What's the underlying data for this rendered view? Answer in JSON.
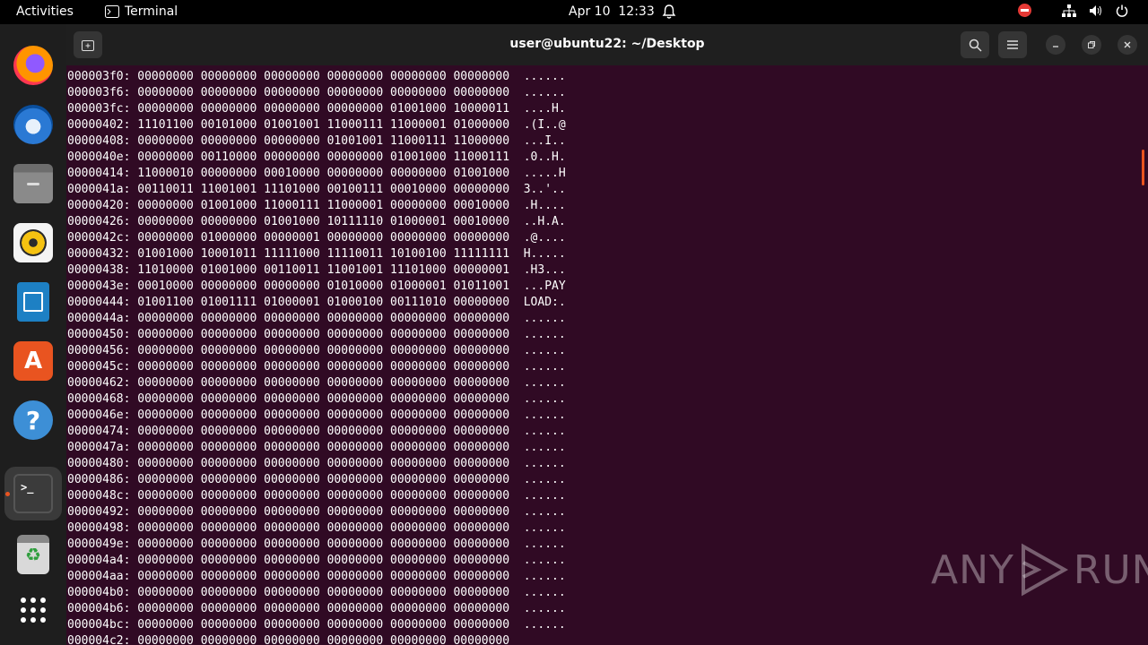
{
  "topbar": {
    "activities": "Activities",
    "app_name": "Terminal",
    "date": "Apr 10",
    "time": "12:33"
  },
  "dock": {
    "items": [
      "firefox-icon",
      "thunderbird-icon",
      "files-icon",
      "rhythmbox-icon",
      "libreoffice-writer-icon",
      "app-center-icon",
      "help-icon",
      "terminal-icon",
      "trash-icon",
      "show-apps-icon"
    ]
  },
  "window": {
    "title": "user@ubuntu22: ~/Desktop"
  },
  "terminal": {
    "lines": [
      "000003f0: 00000000 00000000 00000000 00000000 00000000 00000000  ......",
      "000003f6: 00000000 00000000 00000000 00000000 00000000 00000000  ......",
      "000003fc: 00000000 00000000 00000000 00000000 01001000 10000011  ....H.",
      "00000402: 11101100 00101000 01001001 11000111 11000001 01000000  .(I..@",
      "00000408: 00000000 00000000 00000000 01001001 11000111 11000000  ...I..",
      "0000040e: 00000000 00110000 00000000 00000000 01001000 11000111  .0..H.",
      "00000414: 11000010 00000000 00010000 00000000 00000000 01001000  .....H",
      "0000041a: 00110011 11001001 11101000 00100111 00010000 00000000  3..'..",
      "00000420: 00000000 01001000 11000111 11000001 00000000 00010000  .H....",
      "00000426: 00000000 00000000 01001000 10111110 01000001 00010000  ..H.A.",
      "0000042c: 00000000 01000000 00000001 00000000 00000000 00000000  .@....",
      "00000432: 01001000 10001011 11111000 11110011 10100100 11111111  H.....",
      "00000438: 11010000 01001000 00110011 11001001 11101000 00000001  .H3...",
      "0000043e: 00010000 00000000 00000000 01010000 01000001 01011001  ...PAY",
      "00000444: 01001100 01001111 01000001 01000100 00111010 00000000  LOAD:.",
      "0000044a: 00000000 00000000 00000000 00000000 00000000 00000000  ......",
      "00000450: 00000000 00000000 00000000 00000000 00000000 00000000  ......",
      "00000456: 00000000 00000000 00000000 00000000 00000000 00000000  ......",
      "0000045c: 00000000 00000000 00000000 00000000 00000000 00000000  ......",
      "00000462: 00000000 00000000 00000000 00000000 00000000 00000000  ......",
      "00000468: 00000000 00000000 00000000 00000000 00000000 00000000  ......",
      "0000046e: 00000000 00000000 00000000 00000000 00000000 00000000  ......",
      "00000474: 00000000 00000000 00000000 00000000 00000000 00000000  ......",
      "0000047a: 00000000 00000000 00000000 00000000 00000000 00000000  ......",
      "00000480: 00000000 00000000 00000000 00000000 00000000 00000000  ......",
      "00000486: 00000000 00000000 00000000 00000000 00000000 00000000  ......",
      "0000048c: 00000000 00000000 00000000 00000000 00000000 00000000  ......",
      "00000492: 00000000 00000000 00000000 00000000 00000000 00000000  ......",
      "00000498: 00000000 00000000 00000000 00000000 00000000 00000000  ......",
      "0000049e: 00000000 00000000 00000000 00000000 00000000 00000000  ......",
      "000004a4: 00000000 00000000 00000000 00000000 00000000 00000000  ......",
      "000004aa: 00000000 00000000 00000000 00000000 00000000 00000000  ......",
      "000004b0: 00000000 00000000 00000000 00000000 00000000 00000000  ......",
      "000004b6: 00000000 00000000 00000000 00000000 00000000 00000000  ......",
      "000004bc: 00000000 00000000 00000000 00000000 00000000 00000000  ......",
      "000004c2: 00000000 00000000 00000000 00000000 00000000 00000000"
    ]
  },
  "watermark": {
    "left": "ANY",
    "right": "RUN"
  },
  "colors": {
    "terminal_bg": "#300a24",
    "accent": "#e95420"
  }
}
